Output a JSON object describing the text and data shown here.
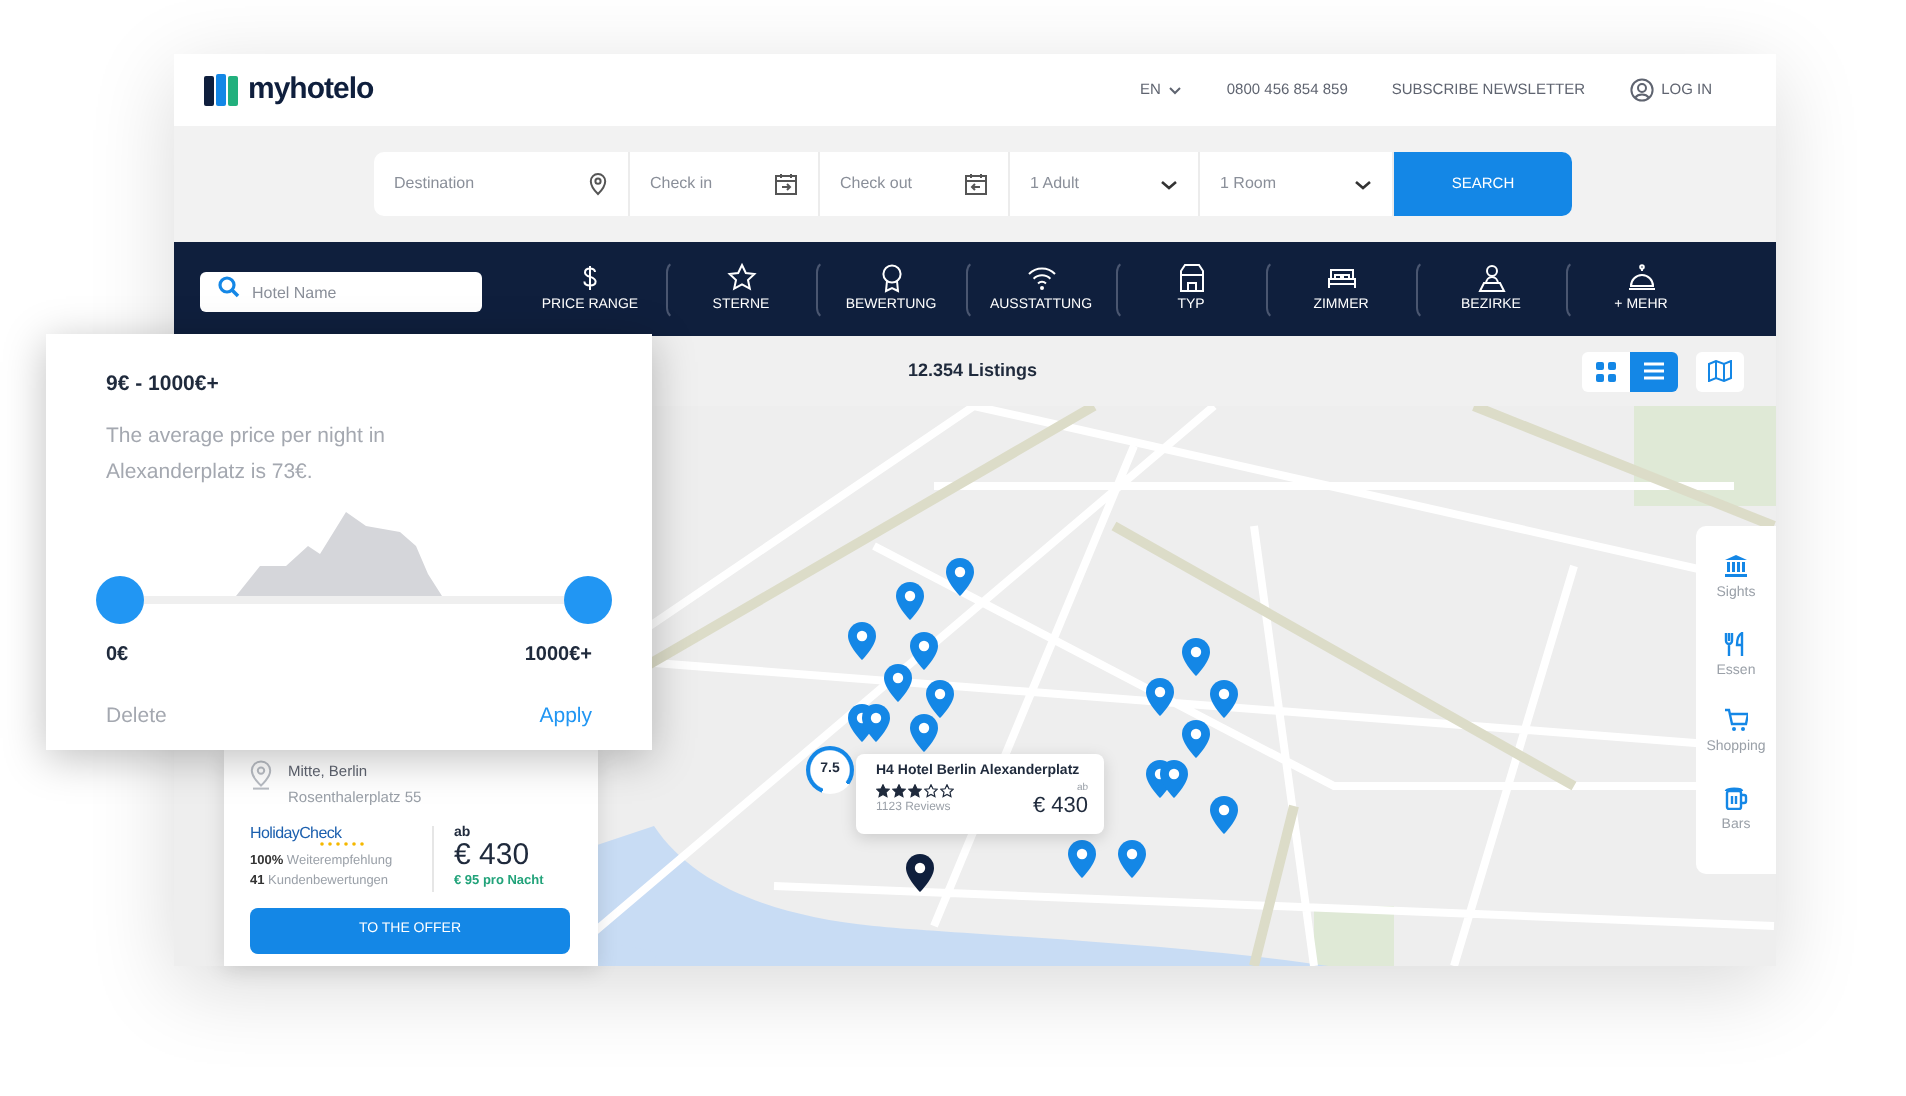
{
  "header": {
    "logo": "myhotelo",
    "language": "EN",
    "phone": "0800 456 854 859",
    "newsletter": "SUBSCRIBE NEWSLETTER",
    "login": "LOG IN"
  },
  "search_bar": {
    "destination": {
      "placeholder": "Destination"
    },
    "check_in": {
      "placeholder": "Check in"
    },
    "check_out": {
      "placeholder": "Check out"
    },
    "adults": "1 Adult",
    "rooms": "1 Room",
    "button": "SEARCH"
  },
  "filter_bar": {
    "hotel_search": {
      "placeholder": "Hotel Name"
    },
    "filters": [
      {
        "label": "PRICE RANGE"
      },
      {
        "label": "STERNE"
      },
      {
        "label": "BEWERTUNG"
      },
      {
        "label": "AUSSTATTUNG"
      },
      {
        "label": "TYP"
      },
      {
        "label": "ZIMMER"
      },
      {
        "label": "BEZIRKE"
      },
      {
        "label": "+ MEHR"
      }
    ]
  },
  "listings": {
    "count": "12.354 Listings",
    "views": [
      {
        "kind": "grid",
        "selected": false
      },
      {
        "kind": "list",
        "selected": true
      },
      {
        "kind": "map",
        "selected": false
      }
    ]
  },
  "price_popup": {
    "range": "9€ - 1000€+",
    "description": "The average price per night in Alexanderplatz is 73€.",
    "slider": {
      "low": {
        "level": 0
      },
      "high": {
        "level": 1
      }
    },
    "min_label": "0€",
    "max_label": "1000€+",
    "delete": "Delete",
    "apply": "Apply"
  },
  "hotel_card": {
    "district": "Mitte, Berlin",
    "address": "Rosenthalerplatz 55",
    "provider": "HolidayCheck",
    "recommendation": "**100%** Weiterempfehlung",
    "reviews": "**41** Kundenbewertungen",
    "price_prefix": "ab",
    "price": "€ 430",
    "per_night": "€ 95 pro Nacht",
    "button": "TO THE OFFER"
  },
  "map_tooltip": {
    "score": "7.5",
    "name": "H4 Hotel Berlin Alexanderplatz",
    "stars": 3,
    "reviews": "1123 Reviews",
    "price_prefix": "ab",
    "price": "€ 430"
  },
  "map_pins": [
    {
      "selected": false
    },
    {
      "selected": false
    },
    {
      "selected": false
    },
    {
      "selected": false
    },
    {
      "selected": false
    },
    {
      "selected": false
    },
    {
      "selected": false
    },
    {
      "selected": false
    },
    {
      "selected": false
    },
    {
      "selected": false
    },
    {
      "selected": false
    },
    {
      "selected": false
    },
    {
      "selected": false
    },
    {
      "selected": false
    },
    {
      "selected": false
    },
    {
      "selected": false
    },
    {
      "selected": false
    },
    {
      "selected": false
    },
    {
      "selected": true
    }
  ],
  "poi_panel": [
    {
      "label": "Sights"
    },
    {
      "label": "Essen"
    },
    {
      "label": "Shopping"
    },
    {
      "label": "Bars"
    }
  ]
}
